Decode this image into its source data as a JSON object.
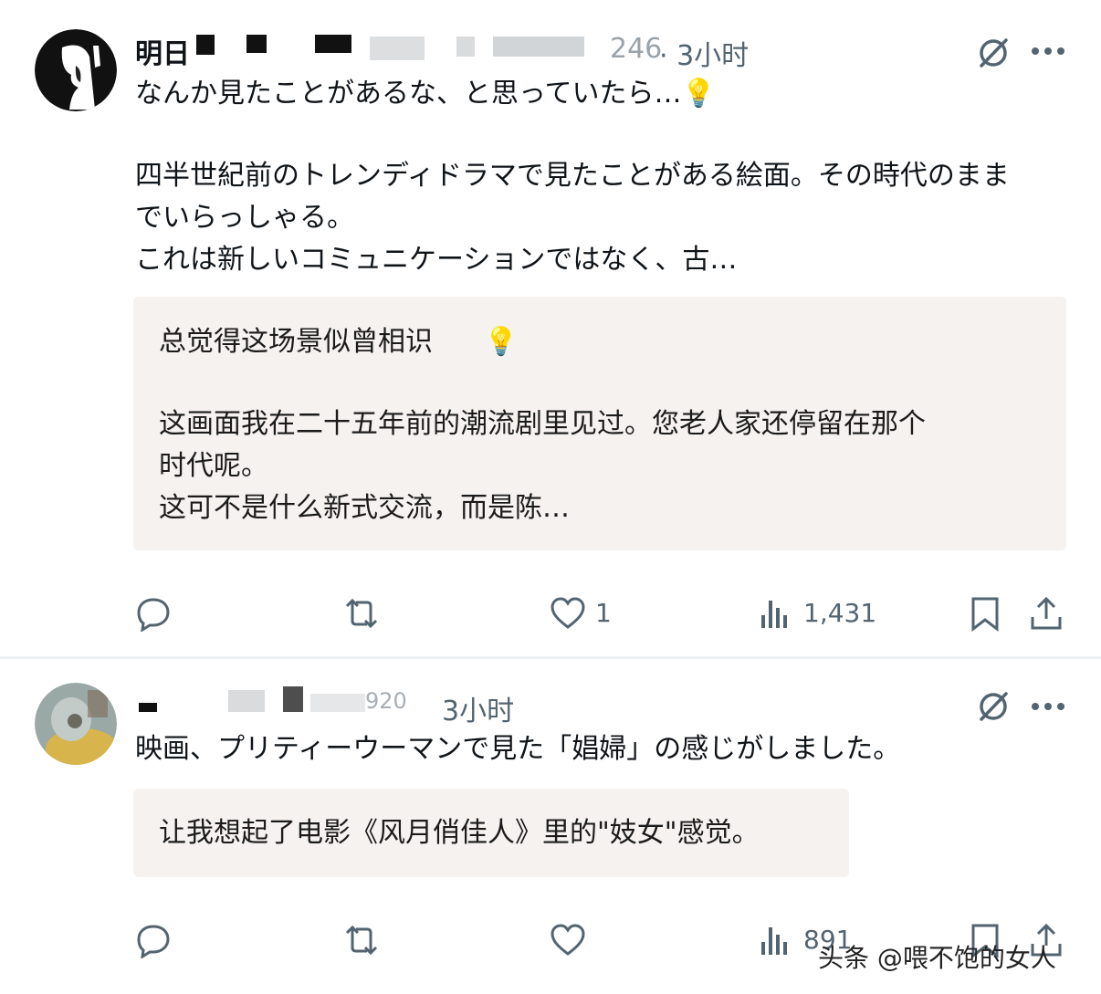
{
  "post1": {
    "name_fragment": "明日",
    "handle_tail": "246",
    "time": "· 3小时",
    "line1": "なんか見たことがあるな、と思っていたら…",
    "line2": "四半世紀前のトレンディドラマで見たことがある絵面。その時代のまま",
    "line3": "でいらっしゃる。",
    "line4": "これは新しいコミュニケーションではなく、古…",
    "translation": {
      "line1": "总觉得这场景似曾相识",
      "line2": "这画面我在二十五年前的潮流剧里见过。您老人家还停留在那个",
      "line3": "时代呢。",
      "line4": "这可不是什么新式交流，而是陈…"
    },
    "actions": {
      "likes": "1",
      "views": "1,431"
    },
    "icons": [
      "bulb-icon",
      "grok-icon",
      "more-icon",
      "reply-icon",
      "retweet-icon",
      "heart-icon",
      "views-icon",
      "bookmark-icon",
      "share-icon"
    ]
  },
  "post2": {
    "handle_tail": "920",
    "time": "3小时",
    "line1": "映画、プリティーウーマンで見た「娼婦」の感じがしました。",
    "translation": {
      "line1": "让我想起了电影《风月俏佳人》里的\"妓女\"感觉。"
    },
    "actions": {
      "views": "891"
    }
  },
  "watermark": "头条 @喂不饱的女人",
  "colors": {
    "text": "#0f1419",
    "muted": "#536471",
    "translation_bg": "#f5f2ef",
    "divider": "#eceef0"
  }
}
